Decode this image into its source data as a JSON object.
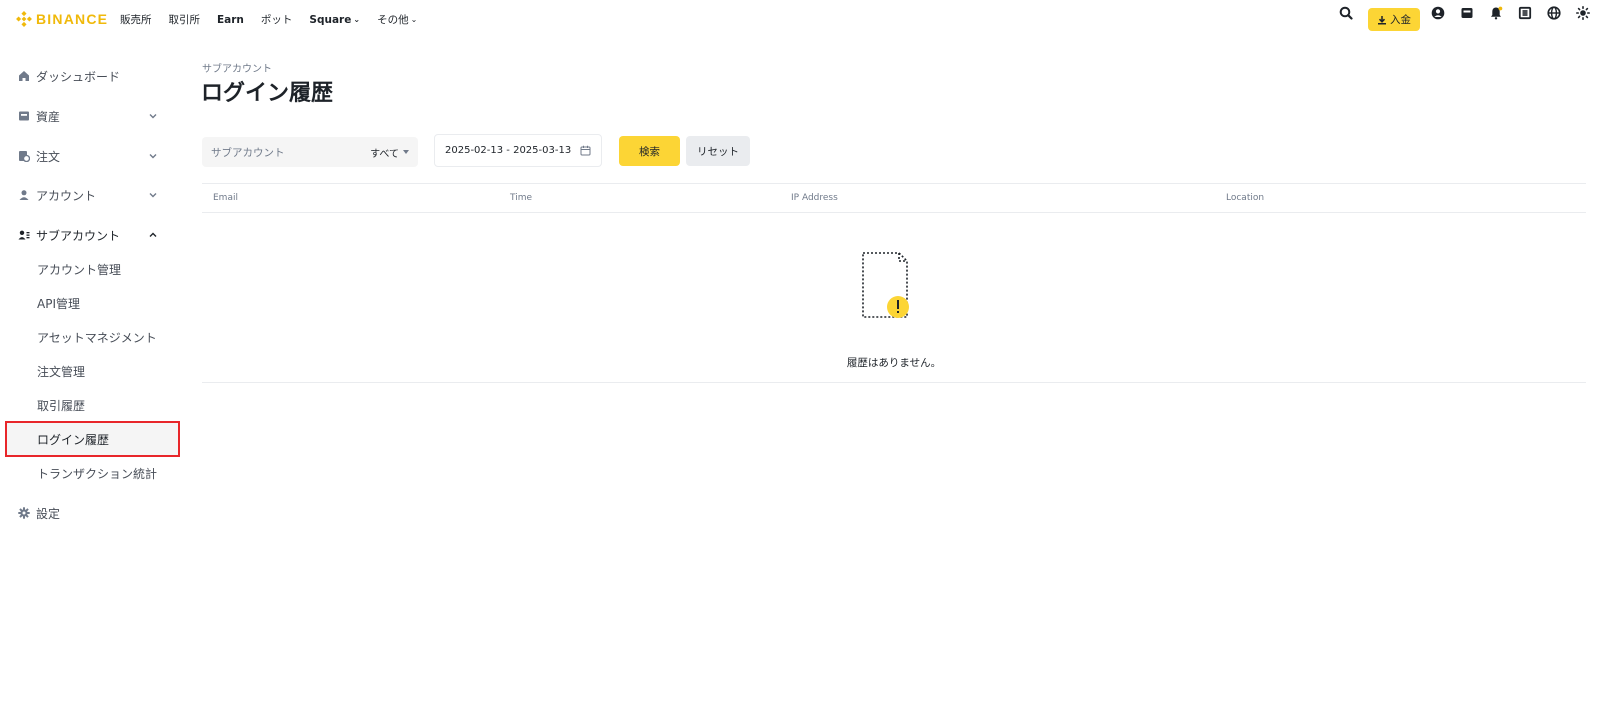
{
  "brand": {
    "name": "BINANCE",
    "color": "#f0b90b"
  },
  "nav": {
    "items": [
      {
        "label": "販売所"
      },
      {
        "label": "取引所"
      },
      {
        "label": "Earn"
      },
      {
        "label": "ポット"
      },
      {
        "label": "Square"
      },
      {
        "label": "その他"
      }
    ]
  },
  "header": {
    "deposit_label": "入金",
    "icons": [
      "search-icon",
      "download-icon",
      "profile-icon",
      "wallet-icon",
      "notification-bell-icon",
      "download-app-icon",
      "globe-icon",
      "theme-toggle-icon"
    ]
  },
  "sidebar": {
    "items": [
      {
        "label": "ダッシュボード",
        "icon": "home-icon"
      },
      {
        "label": "資産",
        "icon": "wallet-icon"
      },
      {
        "label": "注文",
        "icon": "order-icon"
      },
      {
        "label": "アカウント",
        "icon": "user-icon"
      },
      {
        "label": "サブアカウント",
        "icon": "sub-account-icon"
      },
      {
        "label": "アカウント管理"
      },
      {
        "label": "API管理"
      },
      {
        "label": "アセットマネジメント"
      },
      {
        "label": "注文管理"
      },
      {
        "label": "取引履歴"
      },
      {
        "label": "ログイン履歴"
      },
      {
        "label": "トランザクション統計"
      },
      {
        "label": "設定",
        "icon": "settings-icon"
      }
    ]
  },
  "page": {
    "breadcrumb": "サブアカウント",
    "title": "ログイン履歴"
  },
  "filters": {
    "subaccount_placeholder": "サブアカウント",
    "subaccount_select": "すべて",
    "date_range": "2025-02-13 - 2025-03-13",
    "search_label": "検索",
    "reset_label": "リセット"
  },
  "table": {
    "columns": [
      "Email",
      "Time",
      "IP Address",
      "Location"
    ],
    "empty_text": "履歴はありません。"
  },
  "colors": {
    "accent": "#fcd535",
    "selected_outline": "#e8262a"
  }
}
